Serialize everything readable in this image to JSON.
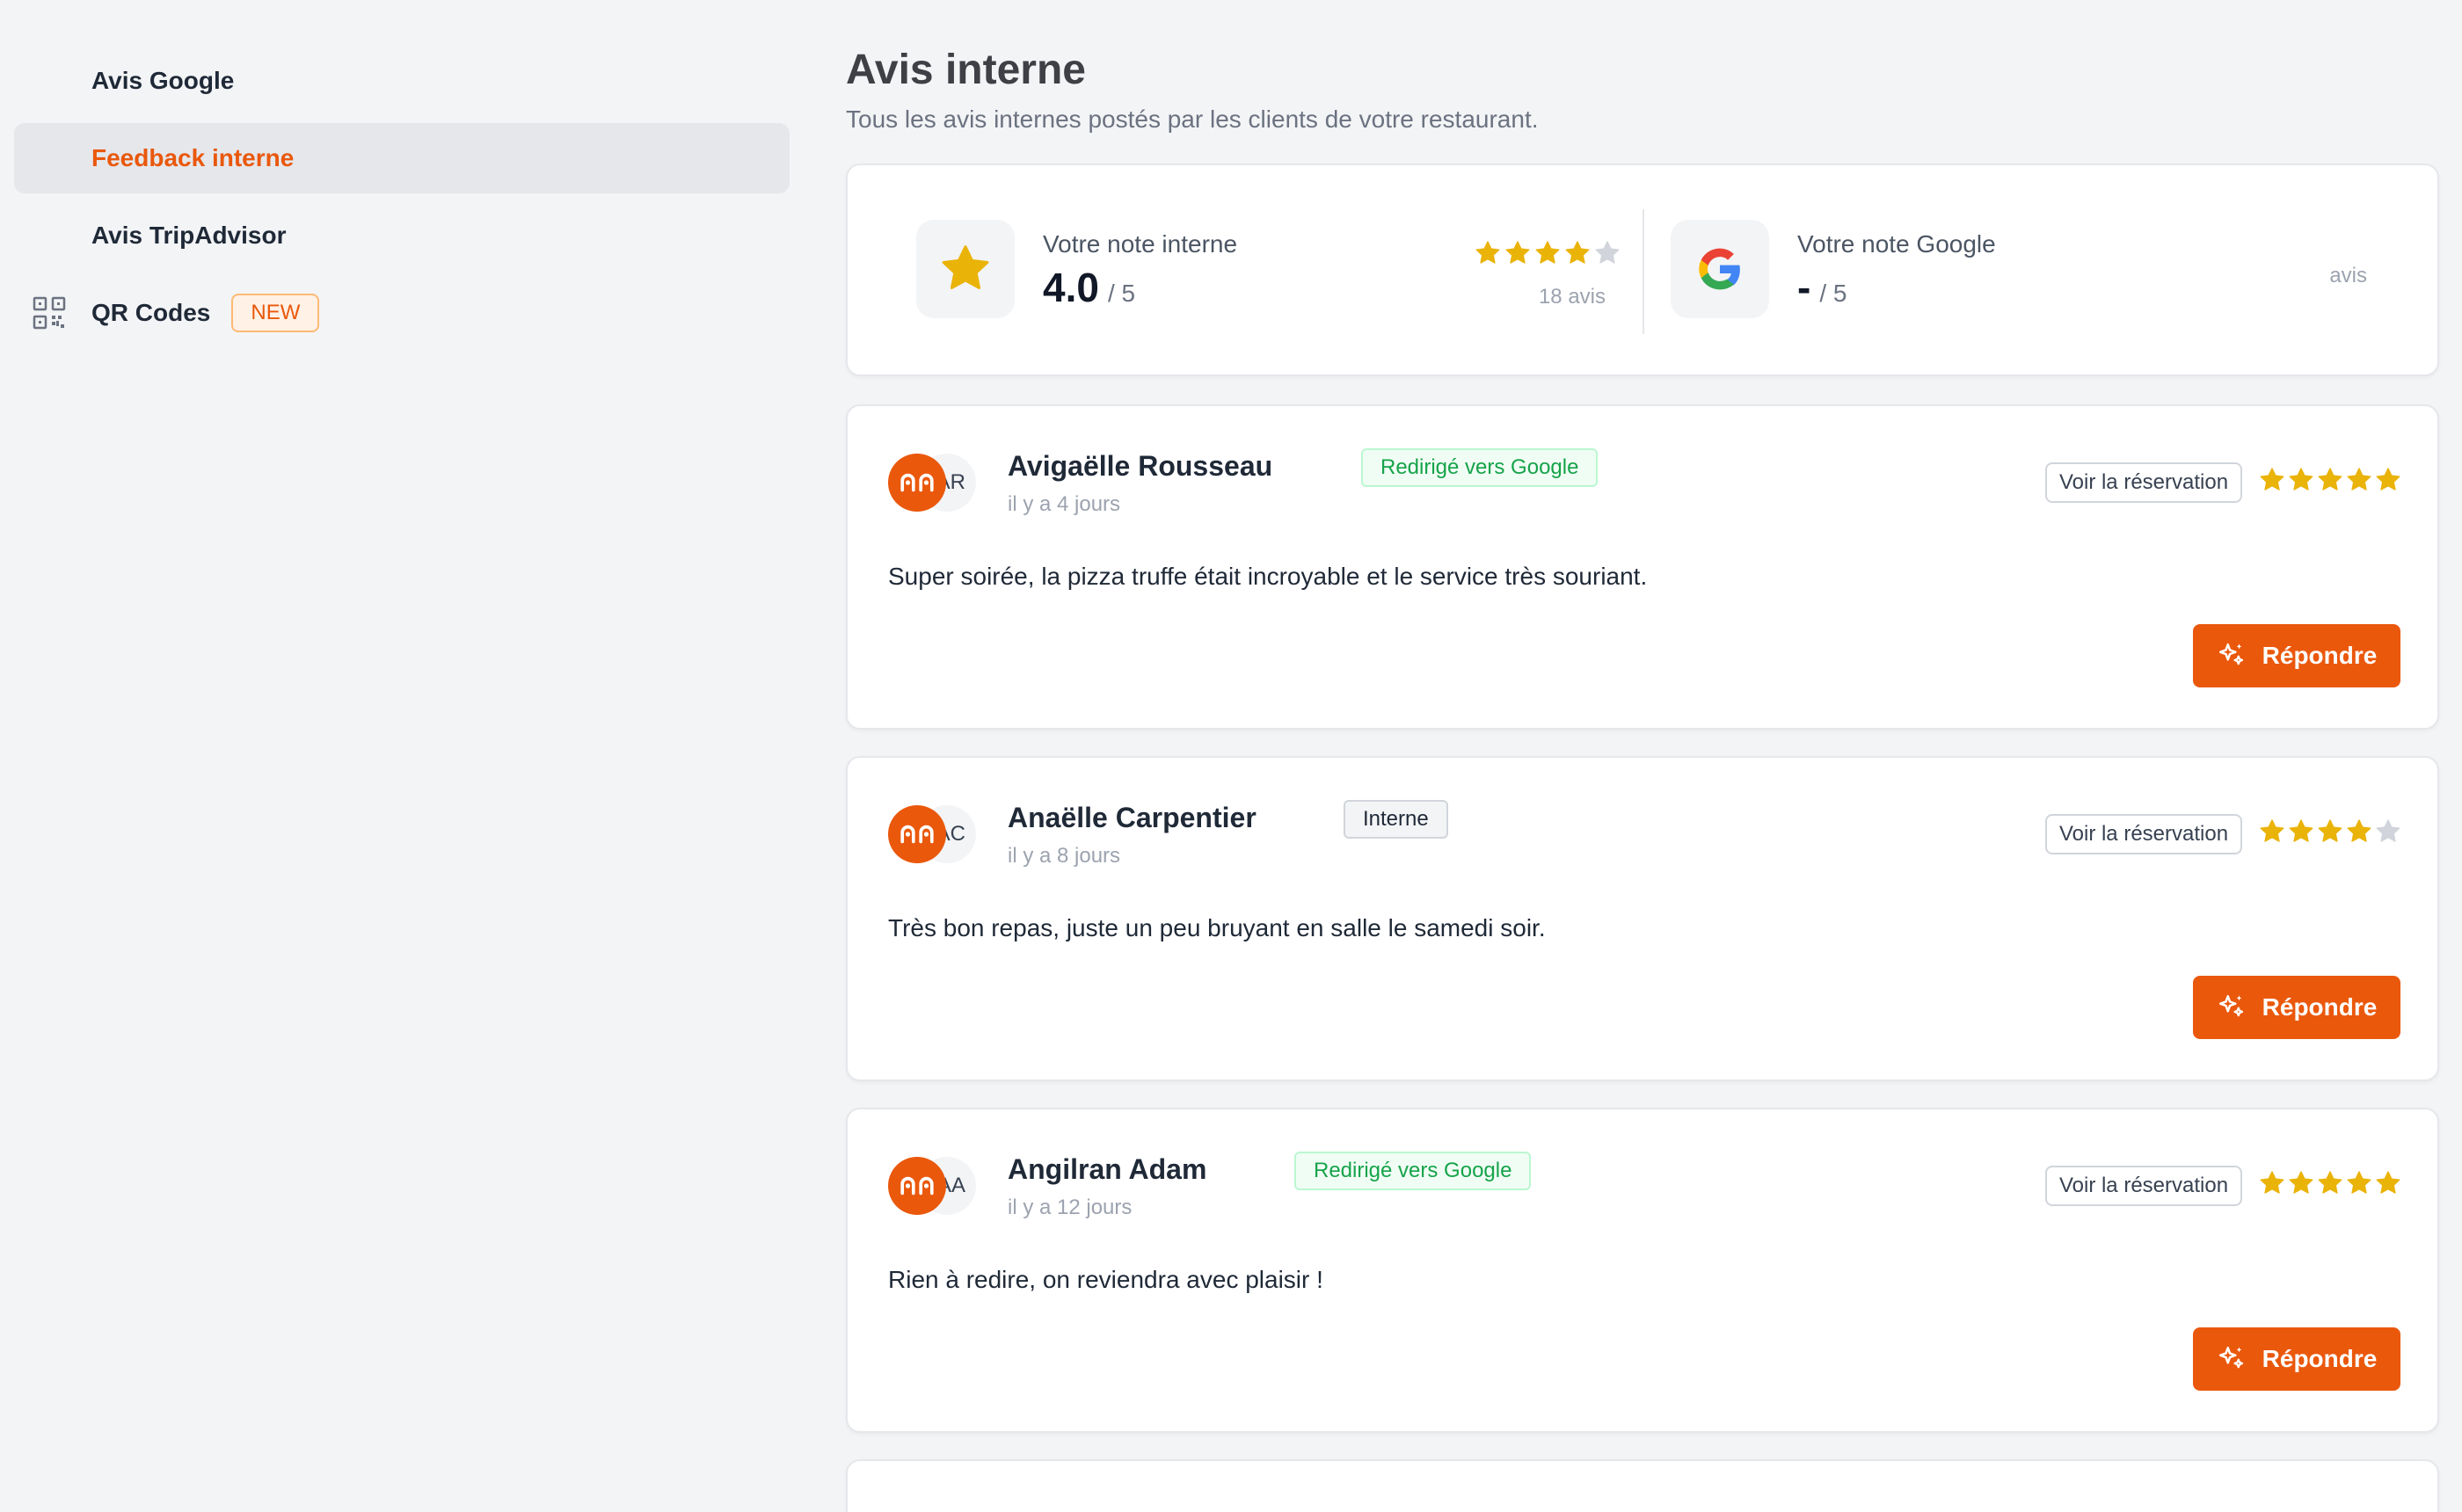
{
  "sidebar": {
    "items": [
      {
        "label": "Avis Google",
        "active": false
      },
      {
        "label": "Feedback interne",
        "active": true
      },
      {
        "label": "Avis TripAdvisor",
        "active": false
      },
      {
        "label": "QR Codes",
        "badge": "NEW",
        "icon": "qr-code-icon"
      }
    ]
  },
  "header": {
    "title": "Avis interne",
    "subtitle": "Tous les avis internes postés par les clients de votre restaurant."
  },
  "summary": {
    "internal": {
      "label": "Votre note interne",
      "value": "4.0",
      "scale": "/ 5",
      "rating": 4,
      "count_label": "18 avis",
      "icon": "star-icon"
    },
    "google": {
      "label": "Votre note Google",
      "value": "-",
      "scale": "/ 5",
      "count_label": "avis",
      "icon": "google-logo-icon"
    }
  },
  "reviews": [
    {
      "initials": "AR",
      "name": "Avigaëlle Rousseau",
      "tag": "Redirigé vers Google",
      "tag_type": "google",
      "time": "il y a 4 jours",
      "rating": 5,
      "text": "Super soirée, la pizza truffe était incroyable et le service très souriant.",
      "resa_label": "Voir la réservation",
      "reply_label": "Répondre"
    },
    {
      "initials": "AC",
      "name": "Anaëlle Carpentier",
      "tag": "Interne",
      "tag_type": "internal",
      "time": "il y a 8 jours",
      "rating": 4,
      "text": "Très bon repas, juste un peu bruyant en salle le samedi soir.",
      "resa_label": "Voir la réservation",
      "reply_label": "Répondre"
    },
    {
      "initials": "AA",
      "name": "Angilran Adam",
      "tag": "Redirigé vers Google",
      "tag_type": "google",
      "time": "il y a 12 jours",
      "rating": 5,
      "text": "Rien à redire, on reviendra avec plaisir !",
      "resa_label": "Voir la réservation",
      "reply_label": "Répondre"
    }
  ],
  "colors": {
    "accent": "#ea580c",
    "star": "#eab308",
    "star_empty": "#d1d5db",
    "google_tag": "#16a34a"
  }
}
